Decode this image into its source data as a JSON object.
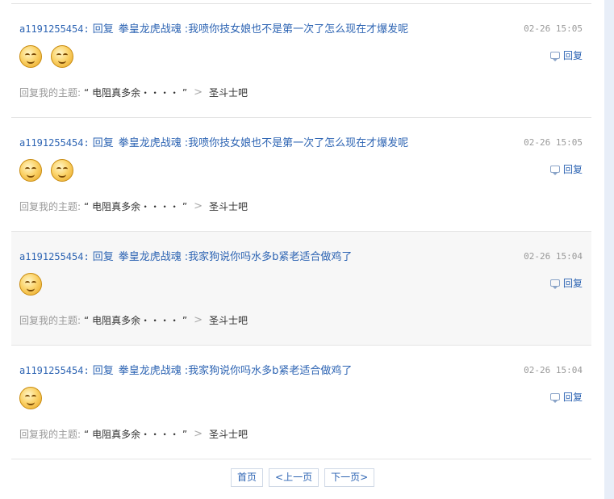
{
  "items": [
    {
      "user": "a1191255454",
      "colon": ":",
      "reply_word": "回复",
      "target": "拳皇龙虎战魂",
      "content": ":我喷你技女娘也不是第一次了怎么现在才爆发呢",
      "time": "02-26 15:05",
      "emoji_count": 2,
      "reply_label": "回复",
      "topic_label": "回复我的主题:",
      "topic_title": "“ 电阻真多余・・・・ ”",
      "forum": "圣斗士吧",
      "highlighted": false
    },
    {
      "user": "a1191255454",
      "colon": ":",
      "reply_word": "回复",
      "target": "拳皇龙虎战魂",
      "content": ":我喷你技女娘也不是第一次了怎么现在才爆发呢",
      "time": "02-26 15:05",
      "emoji_count": 2,
      "reply_label": "回复",
      "topic_label": "回复我的主题:",
      "topic_title": "“ 电阻真多余・・・・ ”",
      "forum": "圣斗士吧",
      "highlighted": false
    },
    {
      "user": "a1191255454",
      "colon": ":",
      "reply_word": "回复",
      "target": "拳皇龙虎战魂",
      "content": ":我家狗说你吗水多b紧老适合做鸡了",
      "time": "02-26 15:04",
      "emoji_count": 1,
      "reply_label": "回复",
      "topic_label": "回复我的主题:",
      "topic_title": "“ 电阻真多余・・・・ ”",
      "forum": "圣斗士吧",
      "highlighted": true
    },
    {
      "user": "a1191255454",
      "colon": ":",
      "reply_word": "回复",
      "target": "拳皇龙虎战魂",
      "content": ":我家狗说你吗水多b紧老适合做鸡了",
      "time": "02-26 15:04",
      "emoji_count": 1,
      "reply_label": "回复",
      "topic_label": "回复我的主题:",
      "topic_title": "“ 电阻真多余・・・・ ”",
      "forum": "圣斗士吧",
      "highlighted": false
    }
  ],
  "pagination": {
    "first": "首页",
    "prev": "<上一页",
    "next": "下一页>"
  },
  "icons": {
    "reply": "speech-bubble-icon",
    "emoji": "smiley-emoji-icon",
    "separator": "chevron-right-icon"
  },
  "colors": {
    "link": "#2d64b3",
    "muted": "#999999",
    "highlight_bg": "#f7f7f7",
    "divider": "#e4e4e4"
  }
}
